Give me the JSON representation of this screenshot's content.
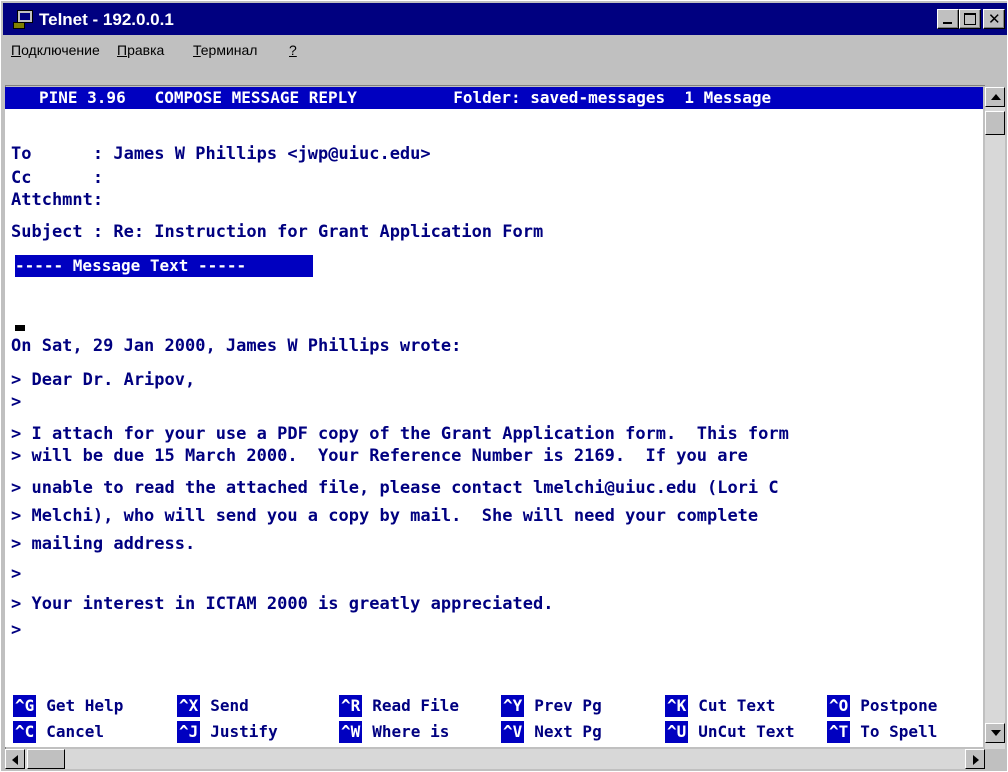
{
  "window": {
    "title": "Telnet - 192.0.0.1"
  },
  "menu": {
    "items": [
      "Подключение",
      "Правка",
      "Терминал",
      "?"
    ]
  },
  "pine": {
    "status_line": "PINE 3.96   COMPOSE MESSAGE REPLY          Folder: saved-messages  1 Message",
    "header_lines": [
      "To      : James W Phillips <jwp@uiuc.edu>",
      "Cc      :",
      "Attchmnt:",
      "Subject : Re: Instruction for Grant Application Form"
    ],
    "message_text_marker": "----- Message Text -----",
    "body_lines": [
      "On Sat, 29 Jan 2000, James W Phillips wrote:",
      "",
      "> Dear Dr. Aripov,",
      ">",
      "> I attach for your use a PDF copy of the Grant Application form.  This form",
      "> will be due 15 March 2000.  Your Reference Number is 2169.  If you are",
      "> unable to read the attached file, please contact lmelchi@uiuc.edu (Lori C",
      "> Melchi), who will send you a copy by mail.  She will need your complete",
      "> mailing address.",
      ">",
      "> Your interest in ICTAM 2000 is greatly appreciated.",
      ">"
    ],
    "commands_row1": [
      {
        "key": "^G",
        "label": "Get Help"
      },
      {
        "key": "^X",
        "label": "Send"
      },
      {
        "key": "^R",
        "label": "Read File"
      },
      {
        "key": "^Y",
        "label": "Prev Pg"
      },
      {
        "key": "^K",
        "label": "Cut Text"
      },
      {
        "key": "^O",
        "label": "Postpone"
      }
    ],
    "commands_row2": [
      {
        "key": "^C",
        "label": "Cancel"
      },
      {
        "key": "^J",
        "label": "Justify"
      },
      {
        "key": "^W",
        "label": "Where is"
      },
      {
        "key": "^V",
        "label": "Next Pg"
      },
      {
        "key": "^U",
        "label": "UnCut Text"
      },
      {
        "key": "^T",
        "label": "To Spell"
      }
    ]
  },
  "colors": {
    "text": "#000080",
    "highlight": "#0000c0",
    "titlebar": "#000080"
  }
}
